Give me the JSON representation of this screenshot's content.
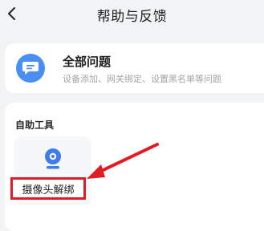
{
  "header": {
    "title": "帮助与反馈"
  },
  "faq_card": {
    "title": "全部问题",
    "subtitle": "设备添加、网关绑定、设置黑名单等问题"
  },
  "tools_section": {
    "title": "自助工具",
    "tools": [
      {
        "label": "摄像头解绑"
      }
    ]
  },
  "colors": {
    "accent": "#4a8df3",
    "annotation": "#e21a23"
  }
}
